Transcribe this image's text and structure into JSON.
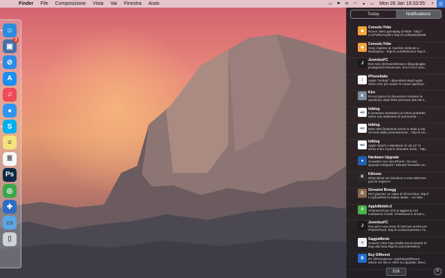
{
  "menubar": {
    "apple_glyph": "",
    "menus": [
      "Finder",
      "File",
      "Composizione",
      "Vista",
      "Vai",
      "Finestra",
      "Aiuto"
    ],
    "clock": "Mon 26 Jan  19:33:55",
    "status_icons": [
      "display-icon",
      "flag-icon",
      "sync-icon",
      "wifi-icon",
      "volume-icon",
      "battery-icon",
      "search-icon",
      "notification-center-icon"
    ]
  },
  "dock": {
    "apps": [
      {
        "name": "finder",
        "glyph": "☺",
        "color": "#2b8de0"
      },
      {
        "name": "preview",
        "glyph": "▣",
        "color": "#4a6fa8",
        "badge": "3"
      },
      {
        "name": "safari",
        "glyph": "⊘",
        "color": "#2a8ce6"
      },
      {
        "name": "app-store",
        "glyph": "A",
        "color": "#1b8ef0"
      },
      {
        "name": "itunes",
        "glyph": "♫",
        "color": "#f04a5a"
      },
      {
        "name": "messages",
        "glyph": "●",
        "color": "#2e94f2"
      },
      {
        "name": "skype",
        "glyph": "S",
        "color": "#00aff0"
      },
      {
        "name": "notes",
        "glyph": "≡",
        "color": "#f3e37a"
      },
      {
        "name": "textedit",
        "glyph": "≣",
        "color": "#f6f6f6"
      },
      {
        "name": "photoshop",
        "glyph": "Ps",
        "color": "#0d2a44"
      },
      {
        "name": "utility",
        "glyph": "◎",
        "color": "#3aa84a"
      },
      {
        "name": "xcode",
        "glyph": "✚",
        "color": "#2e6dc4"
      },
      {
        "name": "folder",
        "glyph": "▭",
        "color": "#5aa6e6"
      },
      {
        "name": "trash",
        "glyph": "▯",
        "color": "#cfd3d8"
      }
    ]
  },
  "notification_center": {
    "tabs": [
      "Today",
      "Notifications"
    ],
    "active_tab": "Notifications",
    "notifications": [
      {
        "app": "Console-Tribe",
        "icon": "console-tribe-icon",
        "glyph": "◆",
        "color": "#f2a33a",
        "lines": [
          "Nuovo video gameplay di Ride - http://",
          "t.co/7Wfu4Yy6iF1 http://t.co/Ry6DQ5tW6"
        ]
      },
      {
        "app": "Console-Tribe",
        "icon": "console-tribe-icon",
        "glyph": "◆",
        "color": "#f2a33a",
        "lines": [
          "Sony registra un marchio dedicato a",
          "Resistance - http://t.co/SRDkv3HJ http://..."
        ]
      },
      {
        "app": "JuventusFC",
        "icon": "juventus-icon",
        "glyph": "J",
        "color": "#1a1a1a",
        "lines": [
          "Non solo @AlvaroMorata e @paulpogba",
          "protagonisti #InsieJuve. Ecco chi è veru..."
        ]
      },
      {
        "app": "iPhoneItalia",
        "icon": "iphoneitalia-icon",
        "glyph": "i",
        "color": "#f6f6f6",
        "lines": [
          "Apple \"recluta\" i dipendenti degli Apple",
          "Store USA per aviare le nuove aperture..."
        ]
      },
      {
        "app": "Kiro",
        "icon": "kiro-icon",
        "glyph": "K",
        "color": "#7a8a9a",
        "lines": [
          "Poi un giorno la dovremmo risolvere la",
          "questione degli SMS premium dati dai s..."
        ]
      },
      {
        "app": "hdblog",
        "icon": "hdblog-icon",
        "glyph": "HD",
        "color": "#ffffff",
        "lines": [
          "È prossimo ZenWatch di ASUS potrebbe",
          "avere una settimana di autonomia - ..."
        ]
      },
      {
        "app": "hdblog",
        "icon": "hdblog-icon",
        "glyph": "HD",
        "color": "#ffffff",
        "lines": [
          "Moto 360 finalmente arriva in Italia a soli",
          "15 mesi dalla presentazione... http://t.co/..."
        ]
      },
      {
        "app": "hdblog",
        "icon": "hdblog-icon",
        "glyph": "HD",
        "color": "#ffffff",
        "lines": [
          "Apple Watch e MacBook Air da 12\" in",
          "arrivo entro il primo trimestre 2015... http..."
        ]
      },
      {
        "app": "Hardware Upgrade",
        "icon": "hardware-upgrade-icon",
        "glyph": "●",
        "color": "#1f5fb0",
        "lines": [
          "Snowden non usa iPhone: 'Ha uno",
          "spyware integrato': Edward Snowden av..."
        ]
      },
      {
        "app": "Killzone",
        "icon": "killzone-icon",
        "glyph": "K",
        "color": "#2a2a2a",
        "lines": [
          "What about we introduce a new Warzone",
          "just for snipers?"
        ]
      },
      {
        "app": "Giovanni Broegg",
        "icon": "giovanni-broegg-icon",
        "glyph": "G",
        "color": "#8a6a52",
        "lines": [
          "Mi è piaciuto un video di @YouTube: http://",
          "t.co/jhvaPMcT5 Italian Madic - Un SIM..."
        ]
      },
      {
        "app": "AppleMobile.it",
        "icon": "applemobile-icon",
        "glyph": "A",
        "color": "#47b34a",
        "lines": [
          "1Password per iOS si aggiorna con",
          "moltissime novità: 1Password è ormai u..."
        ]
      },
      {
        "app": "JuventusFC",
        "icon": "juventus-icon",
        "glyph": "J",
        "color": "#1a1a1a",
        "lines": [
          "Due gol e una news di mercato anche per",
          "#TalentTrack: http://t.co/S3cKaDSSLY ht..."
        ]
      },
      {
        "app": "SaggiaMente",
        "icon": "saggiamente-icon",
        "glyph": "S",
        "color": "#f0f0f0",
        "lines": [
          "Amazon ritira l'app Wallet annunciando lo",
          "stop alla beta http://t.co/yAn6mWkVy"
        ]
      },
      {
        "app": "Buy Different",
        "icon": "buy-different-icon",
        "glyph": "B",
        "color": "#1e6fd0",
        "lines": [
          "RT @Persasmac: Saldi BuyDifferent:",
          "ultime ore fino a -60% su upgrade, iDevi..."
        ]
      }
    ],
    "edit_label": "Edit",
    "settings_icon": "gear-icon"
  }
}
